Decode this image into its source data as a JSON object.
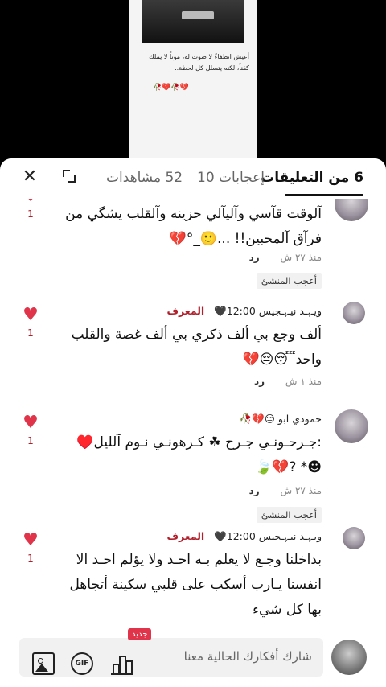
{
  "video": {
    "caption": "أعيش انطفاءً لا صوت له، موتاً لا يملك كفناً، لكنه يتسلل كل لحظة..",
    "caption_emoji": "🥀💔🥀💔"
  },
  "tabs": {
    "comments": "6 من التعليقات",
    "likes": "إعجابات 10",
    "views": "52 مشاهدات"
  },
  "comments": [
    {
      "author": "",
      "badge": "",
      "text": "آلوقت قآسي وآليآلي حزينه وآلقلب يشگي من فرآق آلمحبين!! ...🙂_°💔",
      "time": "منذ ٢٧ ش",
      "reply": "رد",
      "creator_liked": "أعجب المنشئ",
      "likes": "1"
    },
    {
      "author": "ويـﮩـد نيـﮩـجيس 12:00🖤",
      "badge": "المعرف",
      "text": "ألف وجع بي ألف ذكري بي ألف غصة والقلب واحد😴😔💔",
      "time": "منذ ١ ش",
      "reply": "رد",
      "creator_liked": "",
      "likes": "1"
    },
    {
      "author": "حمودي ابو 😔💔🥀",
      "badge": "",
      "text": ":جـرحـونـي جـرح ☘ كـرهونـي نـوم آلليل♥️☻* ?💔🍃",
      "time": "منذ ٢٧ ش",
      "reply": "رد",
      "creator_liked": "أعجب المنشئ",
      "likes": "1"
    },
    {
      "author": "ويـﮩـد نيـﮩـجيس 12:00🖤",
      "badge": "المعرف",
      "text": "بداخلنا وجـع لا يعلم بـه احـد ولا يؤلم احـد الا انفسنا يـارب أسكب على قلبي سكينة أتجاهل بها كل شيء",
      "time": "",
      "reply": "",
      "creator_liked": "",
      "likes": "1"
    }
  ],
  "composer": {
    "placeholder": "شارك أفكارك الحالية معنا",
    "new_badge": "جديد",
    "gif_label": "GIF"
  },
  "icons": {
    "close": "close-icon",
    "expand": "expand-icon",
    "heart": "heart-icon",
    "image": "image-icon",
    "gif": "gif-icon",
    "poll": "bar-chart-icon"
  },
  "colors": {
    "like_heart": "#e0344a",
    "badge_text": "#b01f2a",
    "new_badge_bg": "#e0344a"
  }
}
